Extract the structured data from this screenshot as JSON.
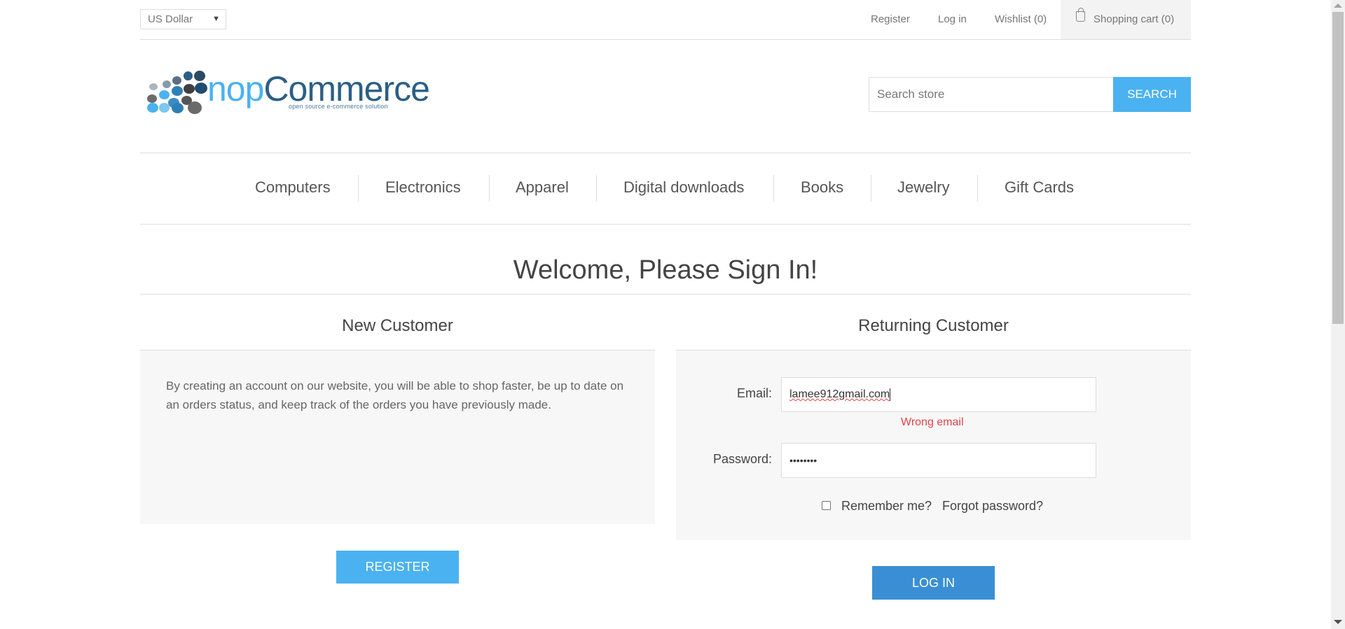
{
  "header": {
    "currency": "US Dollar",
    "links": {
      "register": "Register",
      "login": "Log in",
      "wishlist": "Wishlist (0)",
      "cart": "Shopping cart (0)"
    }
  },
  "logo": {
    "brand_prefix": "nop",
    "brand_suffix": "Commerce",
    "tagline": "open source e-commerce solution"
  },
  "search": {
    "placeholder": "Search store",
    "button": "SEARCH"
  },
  "nav": [
    "Computers",
    "Electronics",
    "Apparel",
    "Digital downloads",
    "Books",
    "Jewelry",
    "Gift Cards"
  ],
  "page_title": "Welcome, Please Sign In!",
  "new_customer": {
    "title": "New Customer",
    "text": "By creating an account on our website, you will be able to shop faster, be up to date on an orders status, and keep track of the orders you have previously made.",
    "register_button": "REGISTER"
  },
  "returning_customer": {
    "title": "Returning Customer",
    "email_label": "Email:",
    "email_value": "lamee912gmail.com",
    "email_error": "Wrong email",
    "password_label": "Password:",
    "password_value": "••••••••",
    "remember_label": "Remember me?",
    "forgot_label": "Forgot password?",
    "login_button": "LOG IN"
  },
  "colors": {
    "accent": "#4ab2f1",
    "login_button": "#3a8fd4",
    "error": "#e4434b",
    "panel_bg": "#f7f7f7",
    "brand_dark": "#2b5f86"
  }
}
